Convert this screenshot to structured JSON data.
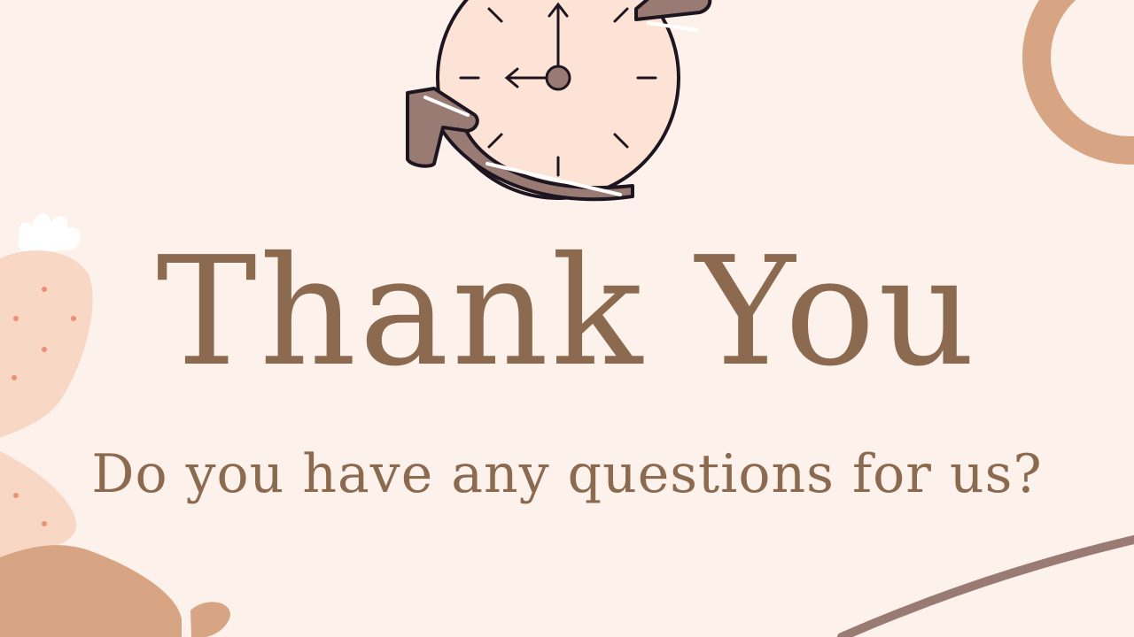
{
  "slide": {
    "title": "Thank You",
    "subtitle": "Do you have any questions for us?"
  },
  "icons": {
    "clock": "clock-refresh-icon"
  },
  "colors": {
    "background": "#fcf1eb",
    "text": "#8b6a4f",
    "clock_face": "#fde3d6",
    "arrow": "#9a7b73",
    "ring": "#d8a584",
    "plant": "#f8d7c4",
    "ground": "#d8a584",
    "line": "#9a7b73"
  }
}
